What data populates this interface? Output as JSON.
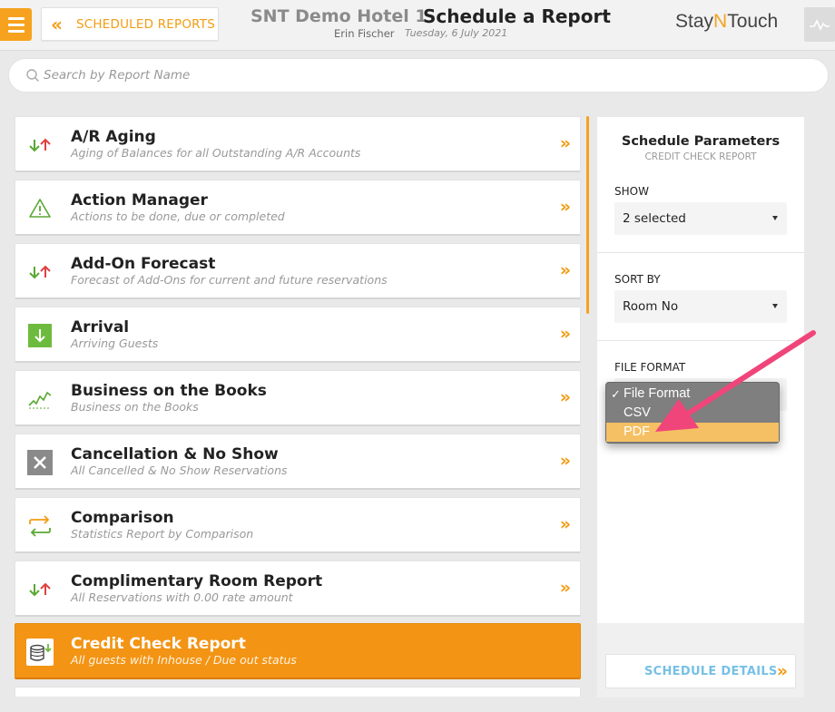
{
  "header": {
    "back_label": "SCHEDULED REPORTS",
    "hotel_name": "SNT Demo Hotel 1",
    "page_title": "Schedule a Report",
    "user_name": "Erin Fischer",
    "date": "Tuesday, 6 July 2021",
    "logo_part1": "Stay",
    "logo_part2": "N",
    "logo_part3": "Touch"
  },
  "search": {
    "placeholder": "Search by Report Name"
  },
  "reports": [
    {
      "title": "A/R Aging",
      "subtitle": "Aging of Balances for all Outstanding A/R Accounts",
      "icon": "up-down-arrows-icon"
    },
    {
      "title": "Action Manager",
      "subtitle": "Actions to be done, due or completed",
      "icon": "warning-icon"
    },
    {
      "title": "Add-On Forecast",
      "subtitle": "Forecast of Add-Ons for current and future reservations",
      "icon": "up-down-arrows-icon"
    },
    {
      "title": "Arrival",
      "subtitle": "Arriving Guests",
      "icon": "arrival-icon"
    },
    {
      "title": "Business on the Books",
      "subtitle": "Business on the Books",
      "icon": "trend-chart-icon"
    },
    {
      "title": "Cancellation & No Show",
      "subtitle": "All Cancelled & No Show Reservations",
      "icon": "cancel-icon"
    },
    {
      "title": "Comparison",
      "subtitle": "Statistics Report by Comparison",
      "icon": "compare-arrows-icon"
    },
    {
      "title": "Complimentary Room Report",
      "subtitle": "All Reservations with 0.00 rate amount",
      "icon": "up-down-arrows-icon"
    },
    {
      "title": "Credit Check Report",
      "subtitle": "All guests with Inhouse / Due out status",
      "icon": "coins-icon",
      "active": true
    }
  ],
  "panel": {
    "title": "Schedule Parameters",
    "subtitle": "CREDIT CHECK REPORT",
    "show_label": "SHOW",
    "show_value": "2 selected",
    "sort_label": "SORT BY",
    "sort_value": "Room No",
    "format_label": "FILE FORMAT",
    "schedule_button": "SCHEDULE DETAILS"
  },
  "dropdown": {
    "options": [
      "File Format",
      "CSV",
      "PDF"
    ],
    "checked": "File Format",
    "highlighted": "PDF",
    "check_mark": "✓"
  },
  "colors": {
    "accent": "#f39c12",
    "active_row": "#f39414",
    "annotation_arrow": "#f0457a",
    "link_blue": "#76c0e6"
  }
}
